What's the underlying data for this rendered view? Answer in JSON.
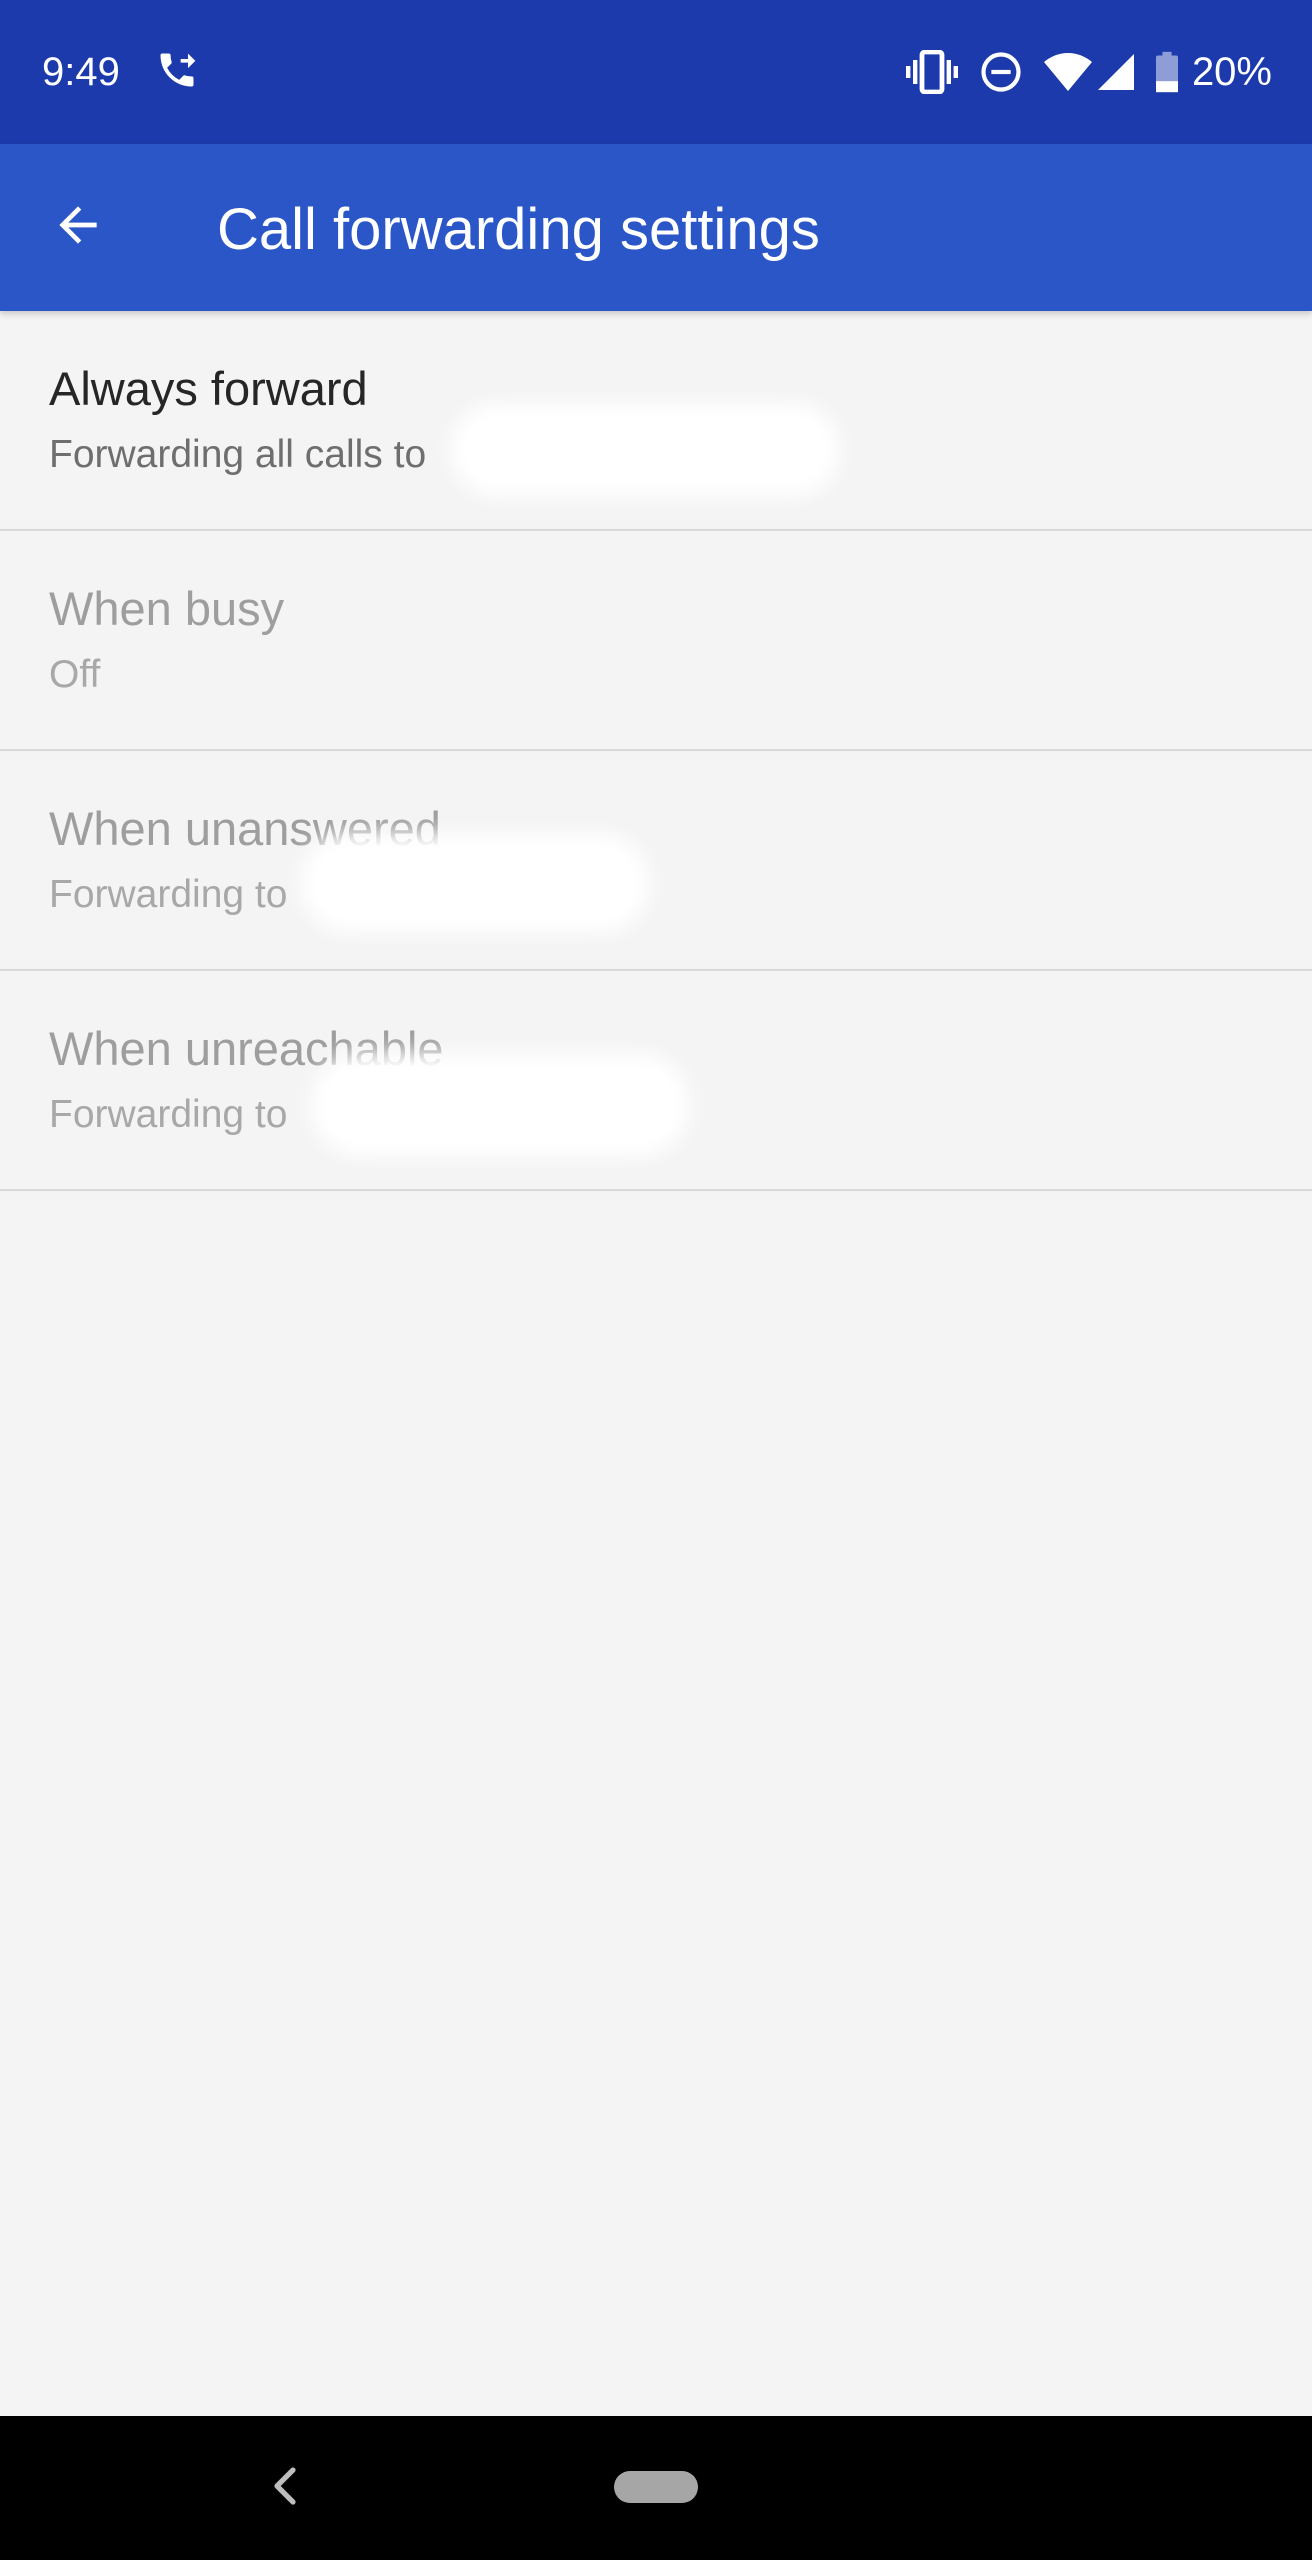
{
  "status_bar": {
    "time": "9:49",
    "battery_percent": "20%",
    "battery_level": 0.2,
    "icons": [
      "call-forward-icon",
      "vibrate-icon",
      "do-not-disturb-icon",
      "wifi-icon",
      "cell-signal-icon",
      "battery-icon"
    ]
  },
  "app_bar": {
    "title": "Call forwarding settings",
    "back_icon": "arrow-back-icon",
    "color": "#2b56c8"
  },
  "settings": [
    {
      "title": "Always forward",
      "summary": "Forwarding all calls to",
      "enabled": true
    },
    {
      "title": "When busy",
      "summary": "Off",
      "enabled": false
    },
    {
      "title": "When unanswered",
      "summary": "Forwarding to",
      "enabled": false
    },
    {
      "title": "When unreachable",
      "summary": "Forwarding to",
      "enabled": false
    }
  ],
  "nav_bar": {
    "back_icon": "chevron-left-icon",
    "home_icon": "home-pill-icon"
  },
  "colors": {
    "status_bar": "#1c3aab",
    "app_bar": "#2b56c8",
    "background": "#f4f4f4"
  }
}
